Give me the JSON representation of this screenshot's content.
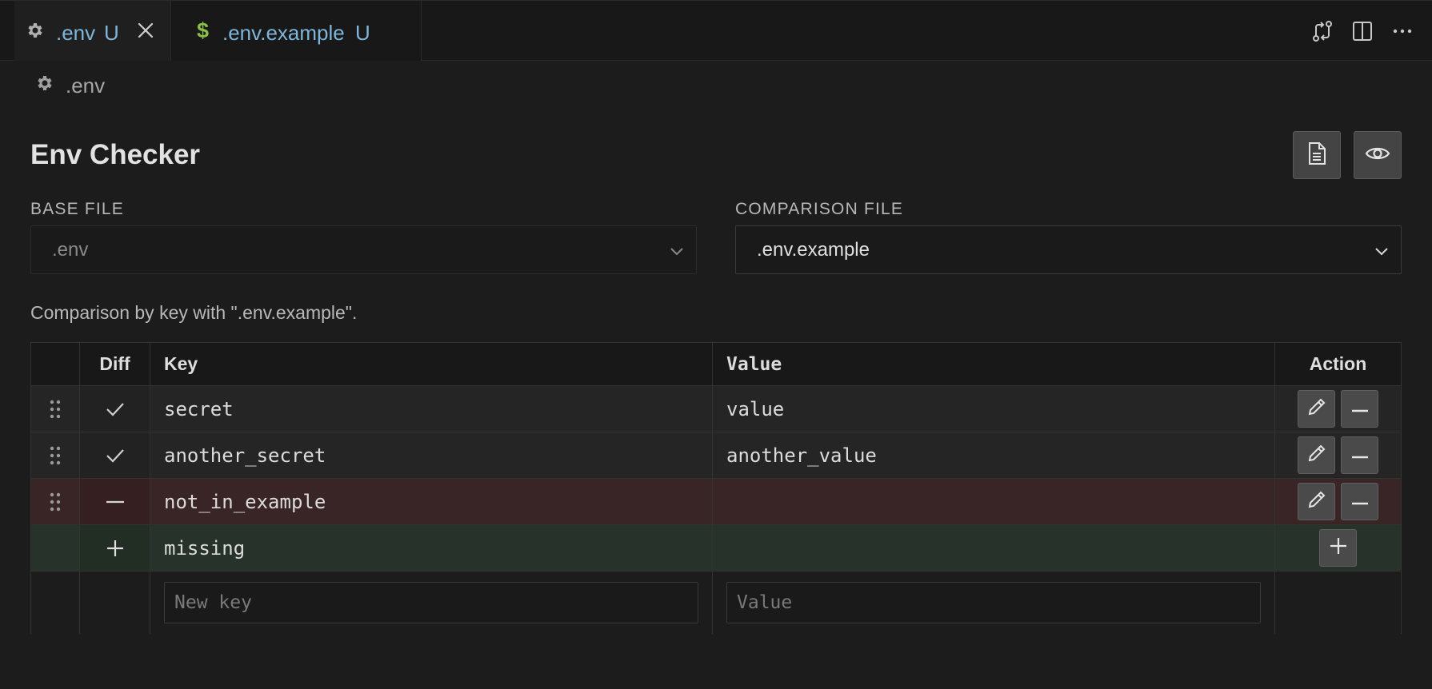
{
  "tabs": [
    {
      "name": ".env",
      "badge": "U"
    },
    {
      "name": ".env.example",
      "badge": "U",
      "icon_char": "$"
    }
  ],
  "breadcrumb": {
    "label": ".env"
  },
  "main": {
    "title": "Env Checker",
    "base_file_label": "BASE FILE",
    "base_file_value": ".env",
    "comparison_file_label": "COMPARISON FILE",
    "comparison_file_value": ".env.example",
    "description": "Comparison by key with \".env.example\"."
  },
  "table": {
    "headers": {
      "diff": "Diff",
      "key": "Key",
      "value": "Value",
      "action": "Action"
    },
    "rows": [
      {
        "diff": "✓",
        "key": "secret",
        "value": "value",
        "status": "same"
      },
      {
        "diff": "✓",
        "key": "another_secret",
        "value": "another_value",
        "status": "same"
      },
      {
        "diff": "—",
        "key": "not_in_example",
        "value": "",
        "status": "removed"
      },
      {
        "diff": "+",
        "key": "missing",
        "value": "",
        "status": "added"
      }
    ],
    "new_row": {
      "key_placeholder": "New key",
      "value_placeholder": "Value"
    }
  },
  "colors": {
    "removed_row": "#3a2526",
    "added_row": "#26322a",
    "tab_text": "#7fb5d9",
    "dollar_icon": "#8cbf4a"
  }
}
